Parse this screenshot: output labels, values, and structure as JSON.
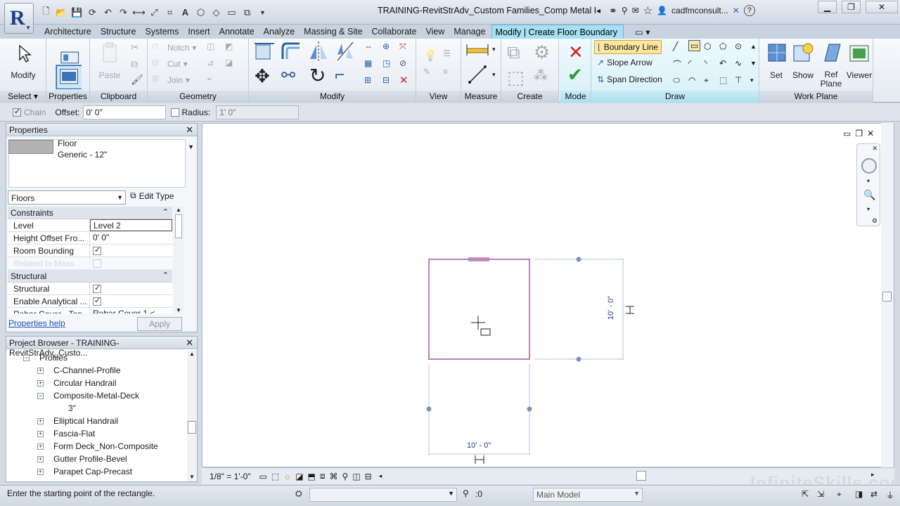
{
  "title_bar": {
    "document_title": "TRAINING-RevitStrAdv_Custom Families_Comp Metal De...",
    "user_label": "cadfmconsult...",
    "help_label": "?"
  },
  "tabs": [
    "Architecture",
    "Structure",
    "Systems",
    "Insert",
    "Annotate",
    "Analyze",
    "Massing & Site",
    "Collaborate",
    "View",
    "Manage",
    "Modify | Create Floor Boundary"
  ],
  "ribbon": {
    "select_label": "Select",
    "modify_label": "Modify",
    "properties_label": "Properties",
    "clipboard_label": "Clipboard",
    "paste_label": "Paste",
    "geometry_label": "Geometry",
    "notch_label": "Notch",
    "cut_label": "Cut",
    "join_label": "Join",
    "modify_panel_label": "Modify",
    "view_label": "View",
    "measure_label": "Measure",
    "create_label": "Create",
    "mode_label": "Mode",
    "draw_label": "Draw",
    "boundary_line_label": "Boundary Line",
    "slope_arrow_label": "Slope Arrow",
    "span_direction_label": "Span Direction",
    "work_plane_label": "Work Plane",
    "set_label": "Set",
    "show_label": "Show",
    "ref_plane_label": "Ref Plane",
    "viewer_label": "Viewer"
  },
  "options_bar": {
    "chain_label": "Chain",
    "offset_label": "Offset:",
    "offset_value": "0'  0\"",
    "radius_label": "Radius:",
    "radius_value": "1'  0\""
  },
  "properties": {
    "title": "Properties",
    "type_family": "Floor",
    "type_name": "Generic - 12\"",
    "category": "Floors",
    "edit_type": "Edit Type",
    "groups": [
      {
        "name": "Constraints",
        "rows": [
          {
            "key": "Level",
            "value": "Level 2",
            "type": "text"
          },
          {
            "key": "Height Offset Fro...",
            "value": "0'  0\"",
            "type": "text"
          },
          {
            "key": "Room Bounding",
            "value": true,
            "type": "check"
          },
          {
            "key": "Related to Mass",
            "value": false,
            "type": "check"
          }
        ]
      },
      {
        "name": "Structural",
        "rows": [
          {
            "key": "Structural",
            "value": true,
            "type": "check"
          },
          {
            "key": "Enable Analytical ...",
            "value": true,
            "type": "check"
          },
          {
            "key": "Rebar Cover - Top...",
            "value": "Rebar Cover 1 <",
            "type": "text"
          }
        ]
      }
    ],
    "help_link": "Properties help",
    "apply": "Apply"
  },
  "project_browser": {
    "title": "Project Browser - TRAINING-RevitStrAdv_Custo...",
    "items": [
      {
        "label": "Profiles",
        "level": 1,
        "state": "open"
      },
      {
        "label": "C-Channel-Profile",
        "level": 2,
        "state": "closed"
      },
      {
        "label": "Circular Handrail",
        "level": 2,
        "state": "closed"
      },
      {
        "label": "Composite-Metal-Deck",
        "level": 2,
        "state": "open"
      },
      {
        "label": "3\"",
        "level": 3,
        "state": "leaf"
      },
      {
        "label": "Elliptical Handrail",
        "level": 2,
        "state": "closed"
      },
      {
        "label": "Fascia-Flat",
        "level": 2,
        "state": "closed"
      },
      {
        "label": "Form Deck_Non-Composite",
        "level": 2,
        "state": "closed"
      },
      {
        "label": "Gutter Profile-Bevel",
        "level": 2,
        "state": "closed"
      },
      {
        "label": "Parapet Cap-Precast",
        "level": 2,
        "state": "closed"
      }
    ]
  },
  "canvas": {
    "dim_horizontal": "10' - 0\"",
    "dim_vertical": "10' - 0\"",
    "accent": "#8b2c8b"
  },
  "view_control": {
    "scale": "1/8\" = 1'-0\""
  },
  "status_bar": {
    "message": "Enter the starting point of the rectangle.",
    "worksets_value": ":0",
    "model": "Main Model"
  },
  "watermark": "InfiniteSkills.com"
}
